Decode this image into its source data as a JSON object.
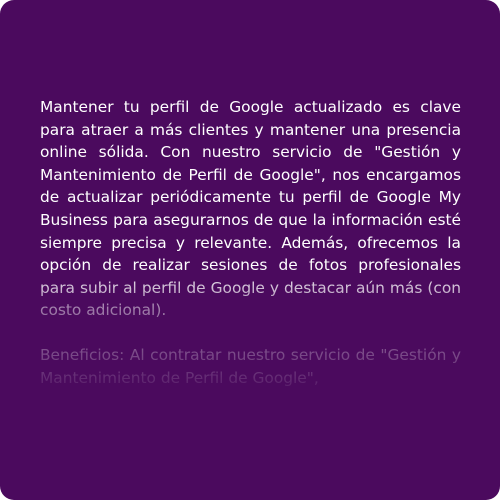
{
  "service_description": {
    "paragraph_1": "Mantener tu perfil de Google actualizado es clave para atraer a más clientes y mantener una presencia online sólida. Con nuestro servicio de \"Gestión y Mantenimiento de Perfil de Google\", nos encargamos de actualizar periódicamente tu perfil de Google My Business para asegurarnos de que la información esté siempre precisa y relevante. Además, ofrecemos la opción de realizar sesiones de fotos profesionales para subir al perfil de Google y destacar aún más (con costo adicional).",
    "paragraph_2": "Beneficios: Al contratar nuestro servicio de \"Gestión y Mantenimiento de Perfil de Google\","
  },
  "colors": {
    "card_background": "#4b0a5e",
    "text": "#ffffff"
  }
}
